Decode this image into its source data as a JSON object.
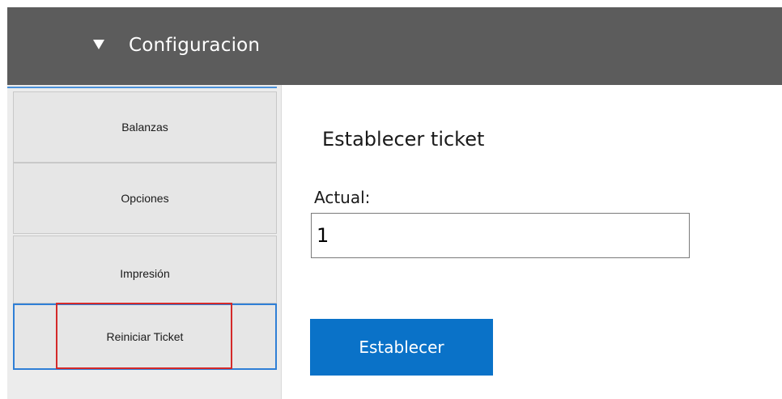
{
  "header": {
    "title": "Configuracion",
    "toggle_icon": "triangle-down-icon"
  },
  "sidebar": {
    "items": [
      {
        "label": "Balanzas"
      },
      {
        "label": "Opciones"
      },
      {
        "label": "Impresión"
      },
      {
        "label": "Reiniciar Ticket",
        "selected": true
      }
    ]
  },
  "main": {
    "section_title": "Establecer ticket",
    "field_label": "Actual:",
    "field_value": "1",
    "submit_label": "Establecer"
  },
  "colors": {
    "header_bg": "#5c5c5c",
    "primary_button": "#0a72c8",
    "selected_border": "#2f7fd6",
    "highlight_annotation": "#d42a2a"
  }
}
